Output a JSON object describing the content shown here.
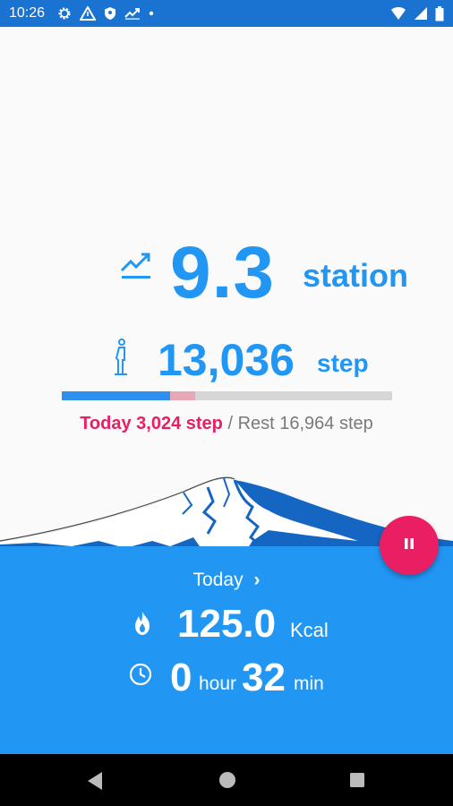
{
  "status_bar": {
    "time": "10:26",
    "icons": [
      "gear-icon",
      "warning-triangle-icon",
      "shield-icon",
      "trending-up-icon",
      "dot-icon"
    ],
    "right_icons": [
      "wifi-icon",
      "cell-signal-icon",
      "battery-icon"
    ]
  },
  "station": {
    "value": "9.3",
    "unit": "station",
    "icon": "trending-up-icon"
  },
  "steps": {
    "value": "13,036",
    "unit": "step",
    "icon": "walking-person-icon",
    "progress_fraction": 0.329,
    "today_fraction": 0.076
  },
  "summary": {
    "today_text": "Today 3,024 step",
    "separator": " / ",
    "rest_text": "Rest 16,964 step"
  },
  "today_link": {
    "label": "Today",
    "chevron": "›"
  },
  "calories": {
    "value": "125.0",
    "unit": "Kcal",
    "icon": "flame-icon"
  },
  "duration": {
    "hours": "0",
    "hour_unit": "hour",
    "minutes": "32",
    "min_unit": "min",
    "icon": "clock-icon"
  },
  "fab": {
    "icon": "pause-icon"
  },
  "colors": {
    "accent": "#2196f3",
    "pink": "#e91e63",
    "status_bar": "#1a73d1",
    "panel": "#2196f3"
  },
  "nav": {
    "icons": [
      "back-triangle-icon",
      "home-circle-icon",
      "recents-square-icon"
    ]
  }
}
